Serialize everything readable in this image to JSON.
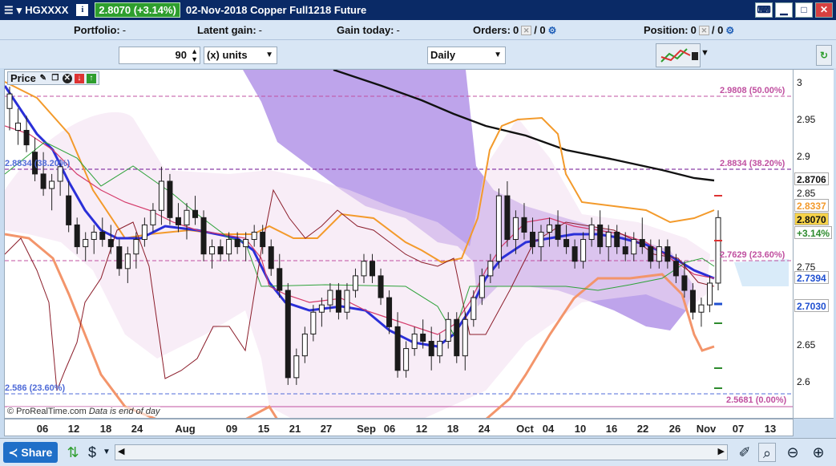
{
  "title": {
    "symbol": "HGXXXX",
    "price_change": "2.8070 (+3.14%)",
    "description": "02-Nov-2018 Copper Full1218 Future"
  },
  "positions": {
    "portfolio_label": "Portfolio:",
    "portfolio_value": "-",
    "latent_label": "Latent gain:",
    "latent_value": "-",
    "today_label": "Gain today:",
    "today_value": "-",
    "orders_label": "Orders:",
    "orders_value_a": "0",
    "orders_value_b": "/ 0",
    "position_label": "Position:",
    "position_value_a": "0",
    "position_value_b": "/ 0"
  },
  "controls": {
    "units_value": "90",
    "units_type": "(x) units",
    "period": "Daily"
  },
  "panel": {
    "name": "Price",
    "copyright": "© ProRealTime.com",
    "note": "Data is end of day"
  },
  "fib_labels": {
    "right_top": "2.9808 (50.00%)",
    "right_mid": "2.8834 (38.20%)",
    "left_mid": "2.8834 (38.20%)",
    "right_low": "2.7629 (23.60%)",
    "left_low": "2.586 (23.60%)",
    "right_bottom": "2.5681 (0.00%)"
  },
  "yaxis": {
    "ticks": [
      "3",
      "2.95",
      "2.9",
      "2.85",
      "2.75",
      "2.65",
      "2.6"
    ],
    "boxes": [
      {
        "label": "2.8706",
        "bg": "#ffffff",
        "color": "#111111"
      },
      {
        "label": "2.8337",
        "bg": "#ffffff",
        "color": "#f39a2b"
      },
      {
        "label": "2.8070",
        "bg": "#f6d34a",
        "color": "#111111"
      },
      {
        "label": "+3.14%",
        "bg": "#ffffff",
        "color": "#2e8b2e"
      },
      {
        "label": "2.7394",
        "bg": "#ffffff",
        "color": "#1f4fd0"
      },
      {
        "label": "2.7030",
        "bg": "#ffffff",
        "color": "#1f4fd0"
      }
    ]
  },
  "xaxis": {
    "labels": [
      "06",
      "12",
      "18",
      "24",
      "Aug",
      "09",
      "15",
      "21",
      "27",
      "Sep",
      "06",
      "12",
      "18",
      "24",
      "Oct",
      "04",
      "10",
      "16",
      "22",
      "26",
      "Nov",
      "07",
      "13"
    ]
  },
  "footer": {
    "share": "Share"
  },
  "colors": {
    "title_bg": "#0a2a66",
    "price_badge": "#2e9e2e",
    "cloud": "#b394e8",
    "ma_blue": "#2a2fd8",
    "ma_black": "#111111",
    "bollinger": "#f39a2b",
    "fib_line": "#c050a0"
  },
  "chart_data": {
    "type": "candlestick",
    "y_range": [
      2.57,
      3.0
    ],
    "ohlc": [
      [
        2.96,
        2.99,
        2.93,
        2.98
      ],
      [
        2.93,
        2.96,
        2.91,
        2.94
      ],
      [
        2.93,
        2.95,
        2.9,
        2.91
      ],
      [
        2.9,
        2.92,
        2.86,
        2.87
      ],
      [
        2.87,
        2.9,
        2.84,
        2.85
      ],
      [
        2.85,
        2.87,
        2.82,
        2.86
      ],
      [
        2.86,
        2.89,
        2.84,
        2.88
      ],
      [
        2.84,
        2.86,
        2.79,
        2.8
      ],
      [
        2.8,
        2.81,
        2.76,
        2.77
      ],
      [
        2.77,
        2.79,
        2.75,
        2.78
      ],
      [
        2.78,
        2.8,
        2.76,
        2.79
      ],
      [
        2.79,
        2.81,
        2.77,
        2.78
      ],
      [
        2.78,
        2.8,
        2.76,
        2.77
      ],
      [
        2.77,
        2.78,
        2.73,
        2.74
      ],
      [
        2.74,
        2.77,
        2.72,
        2.76
      ],
      [
        2.76,
        2.79,
        2.74,
        2.78
      ],
      [
        2.78,
        2.81,
        2.77,
        2.8
      ],
      [
        2.8,
        2.83,
        2.79,
        2.82
      ],
      [
        2.82,
        2.88,
        2.8,
        2.86
      ],
      [
        2.86,
        2.87,
        2.8,
        2.81
      ],
      [
        2.81,
        2.83,
        2.79,
        2.8
      ],
      [
        2.8,
        2.83,
        2.78,
        2.82
      ],
      [
        2.82,
        2.84,
        2.8,
        2.81
      ],
      [
        2.81,
        2.82,
        2.75,
        2.76
      ],
      [
        2.76,
        2.78,
        2.74,
        2.77
      ],
      [
        2.77,
        2.78,
        2.75,
        2.76
      ],
      [
        2.76,
        2.79,
        2.75,
        2.78
      ],
      [
        2.78,
        2.79,
        2.76,
        2.77
      ],
      [
        2.77,
        2.79,
        2.75,
        2.78
      ],
      [
        2.78,
        2.8,
        2.77,
        2.79
      ],
      [
        2.79,
        2.8,
        2.76,
        2.77
      ],
      [
        2.77,
        2.78,
        2.73,
        2.74
      ],
      [
        2.74,
        2.76,
        2.7,
        2.71
      ],
      [
        2.71,
        2.72,
        2.58,
        2.59
      ],
      [
        2.59,
        2.63,
        2.58,
        2.62
      ],
      [
        2.62,
        2.66,
        2.61,
        2.65
      ],
      [
        2.65,
        2.69,
        2.64,
        2.68
      ],
      [
        2.68,
        2.7,
        2.66,
        2.69
      ],
      [
        2.69,
        2.72,
        2.68,
        2.71
      ],
      [
        2.71,
        2.72,
        2.67,
        2.68
      ],
      [
        2.68,
        2.72,
        2.67,
        2.71
      ],
      [
        2.71,
        2.74,
        2.7,
        2.73
      ],
      [
        2.73,
        2.76,
        2.72,
        2.75
      ],
      [
        2.75,
        2.76,
        2.72,
        2.73
      ],
      [
        2.73,
        2.74,
        2.69,
        2.7
      ],
      [
        2.7,
        2.71,
        2.65,
        2.66
      ],
      [
        2.66,
        2.68,
        2.59,
        2.6
      ],
      [
        2.6,
        2.64,
        2.59,
        2.63
      ],
      [
        2.63,
        2.66,
        2.62,
        2.65
      ],
      [
        2.65,
        2.67,
        2.63,
        2.64
      ],
      [
        2.64,
        2.66,
        2.6,
        2.62
      ],
      [
        2.62,
        2.65,
        2.61,
        2.64
      ],
      [
        2.64,
        2.68,
        2.63,
        2.67
      ],
      [
        2.67,
        2.68,
        2.61,
        2.62
      ],
      [
        2.62,
        2.68,
        2.6,
        2.67
      ],
      [
        2.67,
        2.71,
        2.66,
        2.7
      ],
      [
        2.7,
        2.74,
        2.69,
        2.73
      ],
      [
        2.73,
        2.76,
        2.72,
        2.75
      ],
      [
        2.75,
        2.85,
        2.74,
        2.84
      ],
      [
        2.84,
        2.86,
        2.77,
        2.78
      ],
      [
        2.78,
        2.82,
        2.76,
        2.81
      ],
      [
        2.81,
        2.83,
        2.78,
        2.79
      ],
      [
        2.79,
        2.81,
        2.76,
        2.77
      ],
      [
        2.77,
        2.8,
        2.75,
        2.79
      ],
      [
        2.79,
        2.81,
        2.77,
        2.8
      ],
      [
        2.8,
        2.82,
        2.77,
        2.78
      ],
      [
        2.78,
        2.8,
        2.76,
        2.77
      ],
      [
        2.77,
        2.78,
        2.74,
        2.75
      ],
      [
        2.75,
        2.79,
        2.74,
        2.78
      ],
      [
        2.78,
        2.81,
        2.77,
        2.8
      ],
      [
        2.8,
        2.82,
        2.76,
        2.77
      ],
      [
        2.77,
        2.8,
        2.75,
        2.79
      ],
      [
        2.79,
        2.8,
        2.76,
        2.77
      ],
      [
        2.77,
        2.79,
        2.75,
        2.76
      ],
      [
        2.76,
        2.79,
        2.75,
        2.78
      ],
      [
        2.78,
        2.81,
        2.76,
        2.77
      ],
      [
        2.77,
        2.78,
        2.74,
        2.75
      ],
      [
        2.75,
        2.78,
        2.74,
        2.77
      ],
      [
        2.77,
        2.78,
        2.74,
        2.75
      ],
      [
        2.75,
        2.76,
        2.72,
        2.73
      ],
      [
        2.73,
        2.75,
        2.7,
        2.71
      ],
      [
        2.71,
        2.72,
        2.67,
        2.68
      ],
      [
        2.68,
        2.7,
        2.66,
        2.69
      ],
      [
        2.69,
        2.73,
        2.68,
        2.72
      ],
      [
        2.72,
        2.82,
        2.71,
        2.81
      ]
    ]
  }
}
